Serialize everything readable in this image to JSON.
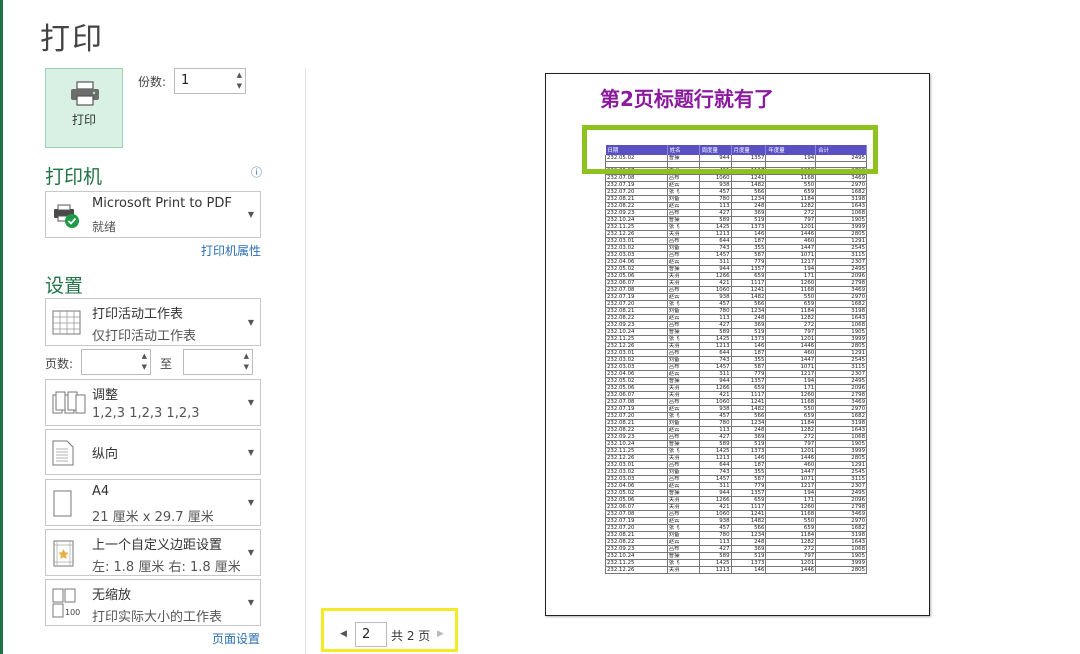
{
  "title": "打印",
  "print_button": {
    "label": "打印"
  },
  "copies": {
    "label": "份数:",
    "value": "1"
  },
  "printer": {
    "heading": "打印机",
    "name": "Microsoft Print to PDF",
    "status": "就绪",
    "properties_link": "打印机属性"
  },
  "settings": {
    "heading": "设置",
    "what": {
      "line1": "打印活动工作表",
      "line2": "仅打印活动工作表"
    },
    "pages": {
      "label": "页数:",
      "from": "",
      "to_label": "至",
      "to": ""
    },
    "collate": {
      "line1": "调整",
      "line2": "1,2,3    1,2,3    1,2,3"
    },
    "orientation": {
      "line1": "纵向"
    },
    "paper": {
      "line1": "A4",
      "line2": "21 厘米 x 29.7 厘米"
    },
    "margins": {
      "line1": "上一个自定义边距设置",
      "line2": "左: 1.8 厘米    右: 1.8 厘米"
    },
    "scaling": {
      "line1": "无缩放",
      "line2": "打印实际大小的工作表"
    },
    "page_setup_link": "页面设置"
  },
  "preview": {
    "annotation": "第2页标题行就有了",
    "header_labels": [
      "日期",
      "姓名",
      "周度量",
      "月度量",
      "年度量",
      "合计"
    ],
    "rows": [
      [
        "232.05.02",
        "曹操",
        "944",
        "1357",
        "194",
        "2495"
      ],
      [
        "232.06.07",
        "关羽",
        "421",
        "1117",
        "1260",
        "2798"
      ],
      [
        "232.07.08",
        "吕布",
        "1060",
        "1241",
        "1168",
        "3469"
      ],
      [
        "232.07.19",
        "赵云",
        "938",
        "1482",
        "550",
        "2970"
      ],
      [
        "232.07.20",
        "张飞",
        "457",
        "566",
        "659",
        "1682"
      ],
      [
        "232.08.21",
        "刘备",
        "780",
        "1234",
        "1184",
        "3198"
      ],
      [
        "232.08.22",
        "赵云",
        "113",
        "248",
        "1282",
        "1643"
      ],
      [
        "232.09.23",
        "吕布",
        "427",
        "369",
        "272",
        "1068"
      ],
      [
        "232.10.24",
        "曹操",
        "589",
        "519",
        "797",
        "1905"
      ],
      [
        "232.11.25",
        "张飞",
        "1425",
        "1373",
        "1201",
        "3999"
      ],
      [
        "232.12.26",
        "关羽",
        "1213",
        "146",
        "1446",
        "2805"
      ],
      [
        "232.03.01",
        "吕布",
        "644",
        "187",
        "460",
        "1291"
      ],
      [
        "232.03.02",
        "刘备",
        "743",
        "355",
        "1447",
        "2545"
      ],
      [
        "232.03.03",
        "吕布",
        "1457",
        "587",
        "1071",
        "3115"
      ],
      [
        "232.04.06",
        "赵云",
        "311",
        "779",
        "1217",
        "2307"
      ],
      [
        "232.05.02",
        "曹操",
        "944",
        "1357",
        "194",
        "2495"
      ],
      [
        "232.05.06",
        "关羽",
        "1266",
        "659",
        "171",
        "2096"
      ],
      [
        "232.06.07",
        "关羽",
        "421",
        "1117",
        "1260",
        "2798"
      ],
      [
        "232.07.08",
        "吕布",
        "1060",
        "1241",
        "1168",
        "3469"
      ],
      [
        "232.07.19",
        "赵云",
        "938",
        "1482",
        "550",
        "2970"
      ],
      [
        "232.07.20",
        "张飞",
        "457",
        "566",
        "659",
        "1682"
      ],
      [
        "232.08.21",
        "刘备",
        "780",
        "1234",
        "1184",
        "3198"
      ],
      [
        "232.08.22",
        "赵云",
        "113",
        "248",
        "1282",
        "1643"
      ],
      [
        "232.09.23",
        "吕布",
        "427",
        "369",
        "272",
        "1068"
      ],
      [
        "232.10.24",
        "曹操",
        "589",
        "519",
        "797",
        "1905"
      ],
      [
        "232.11.25",
        "张飞",
        "1425",
        "1373",
        "1201",
        "3999"
      ],
      [
        "232.12.26",
        "关羽",
        "1213",
        "146",
        "1446",
        "2805"
      ],
      [
        "232.03.01",
        "吕布",
        "644",
        "187",
        "460",
        "1291"
      ],
      [
        "232.03.02",
        "刘备",
        "743",
        "355",
        "1447",
        "2545"
      ],
      [
        "232.03.03",
        "吕布",
        "1457",
        "587",
        "1071",
        "3115"
      ],
      [
        "232.04.06",
        "赵云",
        "311",
        "779",
        "1217",
        "2307"
      ],
      [
        "232.05.02",
        "曹操",
        "944",
        "1357",
        "194",
        "2495"
      ],
      [
        "232.05.06",
        "关羽",
        "1266",
        "659",
        "171",
        "2096"
      ],
      [
        "232.06.07",
        "关羽",
        "421",
        "1117",
        "1260",
        "2798"
      ],
      [
        "232.07.08",
        "吕布",
        "1060",
        "1241",
        "1168",
        "3469"
      ],
      [
        "232.07.19",
        "赵云",
        "938",
        "1482",
        "550",
        "2970"
      ],
      [
        "232.07.20",
        "张飞",
        "457",
        "566",
        "659",
        "1682"
      ],
      [
        "232.08.21",
        "刘备",
        "780",
        "1234",
        "1184",
        "3198"
      ],
      [
        "232.08.22",
        "赵云",
        "113",
        "248",
        "1282",
        "1643"
      ],
      [
        "232.09.23",
        "吕布",
        "427",
        "369",
        "272",
        "1068"
      ],
      [
        "232.10.24",
        "曹操",
        "589",
        "519",
        "797",
        "1905"
      ],
      [
        "232.11.25",
        "张飞",
        "1425",
        "1373",
        "1201",
        "3999"
      ],
      [
        "232.12.26",
        "关羽",
        "1213",
        "146",
        "1446",
        "2805"
      ],
      [
        "232.03.01",
        "吕布",
        "644",
        "187",
        "460",
        "1291"
      ],
      [
        "232.03.02",
        "刘备",
        "743",
        "355",
        "1447",
        "2545"
      ],
      [
        "232.03.03",
        "吕布",
        "1457",
        "587",
        "1071",
        "3115"
      ],
      [
        "232.04.06",
        "赵云",
        "311",
        "779",
        "1217",
        "2307"
      ],
      [
        "232.05.02",
        "曹操",
        "944",
        "1357",
        "194",
        "2495"
      ],
      [
        "232.05.06",
        "关羽",
        "1266",
        "659",
        "171",
        "2096"
      ],
      [
        "232.06.07",
        "关羽",
        "421",
        "1117",
        "1260",
        "2798"
      ],
      [
        "232.07.08",
        "吕布",
        "1060",
        "1241",
        "1168",
        "3469"
      ],
      [
        "232.07.19",
        "赵云",
        "938",
        "1482",
        "550",
        "2970"
      ],
      [
        "232.07.20",
        "张飞",
        "457",
        "566",
        "659",
        "1682"
      ],
      [
        "232.08.21",
        "刘备",
        "780",
        "1234",
        "1184",
        "3198"
      ],
      [
        "232.08.22",
        "赵云",
        "113",
        "248",
        "1282",
        "1643"
      ],
      [
        "232.09.23",
        "吕布",
        "427",
        "369",
        "272",
        "1068"
      ],
      [
        "232.10.24",
        "曹操",
        "589",
        "519",
        "797",
        "1905"
      ],
      [
        "232.11.25",
        "张飞",
        "1425",
        "1373",
        "1201",
        "3999"
      ],
      [
        "232.12.26",
        "关羽",
        "1213",
        "146",
        "1446",
        "2805"
      ]
    ]
  },
  "pager": {
    "current": "2",
    "total_text": "共 2 页"
  },
  "colors": {
    "accent": "#217346",
    "highlight_green": "#8dc21f",
    "highlight_yellow": "#f2ea24",
    "annotation": "#8b1a9e",
    "table_header": "#5b4fc4"
  }
}
